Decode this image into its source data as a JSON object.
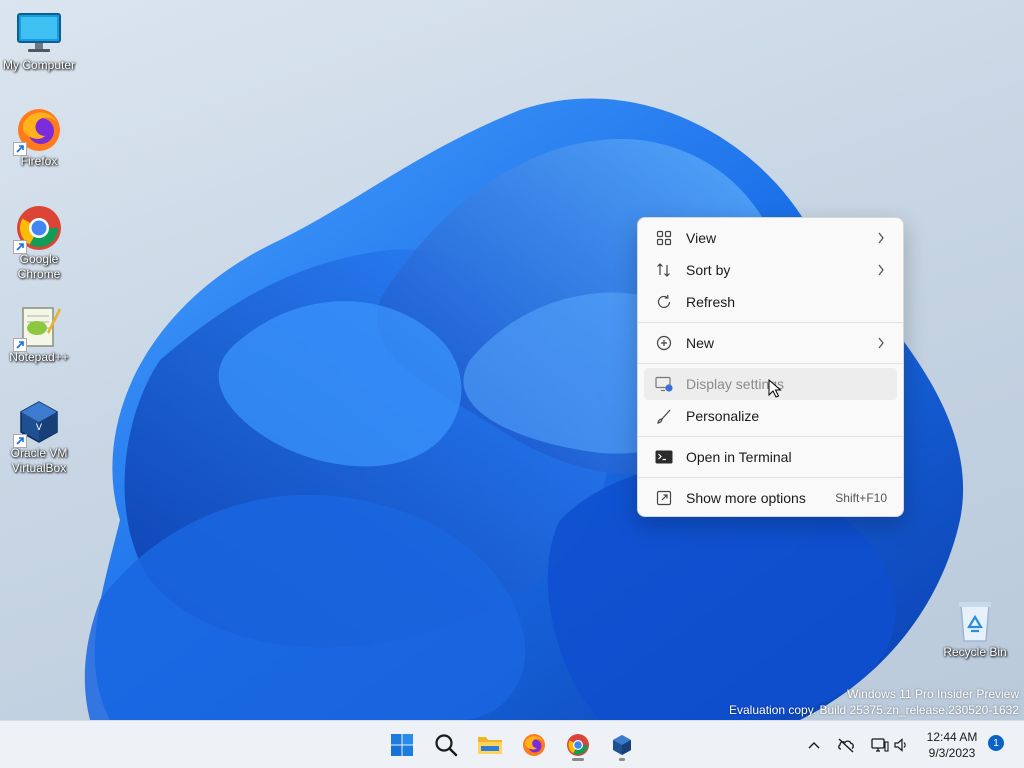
{
  "desktop": {
    "icons": [
      {
        "label": "My Computer",
        "icon": "monitor-icon"
      },
      {
        "label": "Firefox",
        "icon": "firefox-icon"
      },
      {
        "label": "Google Chrome",
        "icon": "chrome-icon"
      },
      {
        "label": "Notepad++",
        "icon": "notepadpp-icon"
      },
      {
        "label": "Oracle VM VirtualBox",
        "icon": "virtualbox-icon"
      },
      {
        "label": "Recycle Bin",
        "icon": "recycle-bin-icon"
      }
    ]
  },
  "context_menu": {
    "items": [
      {
        "label": "View",
        "icon": "view-grid-icon",
        "submenu": true
      },
      {
        "label": "Sort by",
        "icon": "sort-icon",
        "submenu": true
      },
      {
        "label": "Refresh",
        "icon": "refresh-icon"
      },
      {
        "label": "New",
        "icon": "new-plus-icon",
        "submenu": true
      },
      {
        "label": "Display settings",
        "icon": "display-settings-icon",
        "hovered": true
      },
      {
        "label": "Personalize",
        "icon": "personalize-brush-icon"
      },
      {
        "label": "Open in Terminal",
        "icon": "terminal-icon"
      },
      {
        "label": "Show more options",
        "icon": "more-options-icon",
        "shortcut": "Shift+F10"
      }
    ]
  },
  "taskbar": {
    "apps": [
      {
        "name": "Start",
        "icon": "windows-start-icon"
      },
      {
        "name": "Search",
        "icon": "search-icon"
      },
      {
        "name": "File Explorer",
        "icon": "folder-icon"
      },
      {
        "name": "Firefox",
        "icon": "firefox-icon"
      },
      {
        "name": "Google Chrome",
        "icon": "chrome-icon",
        "active": true
      },
      {
        "name": "VirtualBox",
        "icon": "virtualbox-icon",
        "running": true
      }
    ],
    "tray": {
      "icons": [
        "chevron-up-icon",
        "network-off-icon",
        "network-icon",
        "volume-icon"
      ],
      "time": "12:44 AM",
      "date": "9/3/2023",
      "notification_count": "1"
    }
  },
  "watermark": {
    "line1": "Windows 11 Pro Insider Preview",
    "line2": "Evaluation copy. Build 25375.zn_release.230520-1632"
  },
  "colors": {
    "bloom": "#1a6fe8",
    "bloom_dark": "#0b3fb0",
    "accent": "#0a64c8"
  }
}
